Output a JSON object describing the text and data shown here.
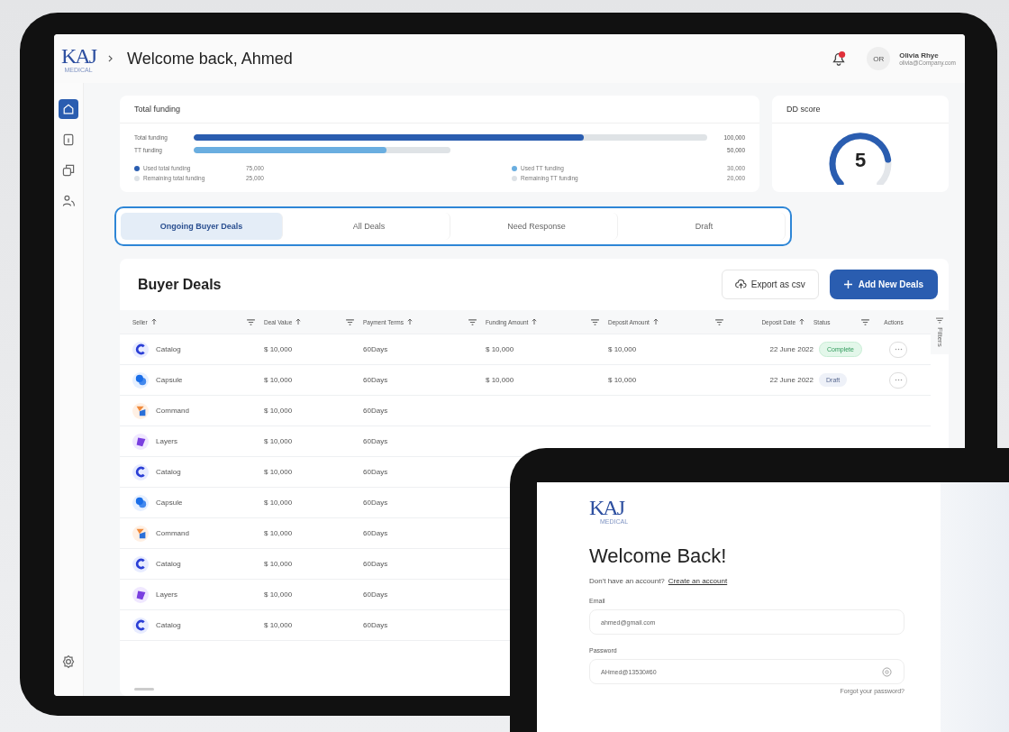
{
  "header": {
    "logo": "KAJ",
    "logo_sub": "MEDICAL",
    "greeting": "Welcome back, Ahmed",
    "notification_badge": true,
    "user": {
      "initials": "OR",
      "name": "Olivia Rhye",
      "email": "olivia@Company.com"
    }
  },
  "sidebar": {
    "items": [
      {
        "kind": "home",
        "selected": true
      },
      {
        "kind": "document",
        "selected": false
      },
      {
        "kind": "copy",
        "selected": false
      },
      {
        "kind": "users",
        "selected": false
      }
    ],
    "bottom": {
      "kind": "settings"
    }
  },
  "funding": {
    "title": "Total funding",
    "bars": [
      {
        "label": "Total funding",
        "level": 0.76,
        "value": "100,000"
      },
      {
        "label": "TT funding",
        "level": 0.75,
        "value": "50,000"
      }
    ],
    "legend": [
      {
        "label": "Used total funding",
        "value": "75,000",
        "color": "#2a5db0"
      },
      {
        "label": "Remaining total funding",
        "value": "25,000",
        "color": "#dde2e6"
      },
      {
        "label": "Used TT funding",
        "value": "30,000",
        "color": "#6aaee0"
      },
      {
        "label": "Remaining TT funding",
        "value": "20,000",
        "color": "#dde2e6"
      }
    ]
  },
  "dd_score": {
    "title": "DD score",
    "level": 0.8,
    "value": "5"
  },
  "tabs": [
    {
      "label": "Ongoing Buyer Deals",
      "selected": true
    },
    {
      "label": "All Deals",
      "selected": false
    },
    {
      "label": "Need Response",
      "selected": false
    },
    {
      "label": "Draft",
      "selected": false
    }
  ],
  "deals": {
    "title": "Buyer Deals",
    "export_button": "Export as csv",
    "add_button": "Add New Deals",
    "filters_label": "Filters",
    "columns": [
      "Seller",
      "Deal Value",
      "Payment Terms",
      "Funding Amount",
      "Deposit Amount",
      "Deposit Date",
      "Status",
      "Actions"
    ],
    "rows": [
      {
        "kind": "catalog",
        "cells": [
          "Catalog",
          "$ 10,000",
          "60Days",
          "$ 10,000",
          "$ 10,000",
          "22 June 2022"
        ],
        "status": {
          "label": "Complete",
          "kind": "complete"
        }
      },
      {
        "kind": "capsule",
        "cells": [
          "Capsule",
          "$ 10,000",
          "60Days",
          "$ 10,000",
          "$ 10,000",
          "22 June 2022"
        ],
        "status": {
          "label": "Draft",
          "kind": "draft"
        }
      },
      {
        "kind": "command",
        "cells": [
          "Command",
          "$ 10,000",
          "60Days"
        ]
      },
      {
        "kind": "layers",
        "cells": [
          "Layers",
          "$ 10,000",
          "60Days"
        ]
      },
      {
        "kind": "catalog",
        "cells": [
          "Catalog",
          "$ 10,000",
          "60Days"
        ]
      },
      {
        "kind": "capsule",
        "cells": [
          "Capsule",
          "$ 10,000",
          "60Days"
        ]
      },
      {
        "kind": "command",
        "cells": [
          "Command",
          "$ 10,000",
          "60Days"
        ]
      },
      {
        "kind": "catalog",
        "cells": [
          "Catalog",
          "$ 10,000",
          "60Days"
        ]
      },
      {
        "kind": "layers",
        "cells": [
          "Layers",
          "$ 10,000",
          "60Days"
        ]
      },
      {
        "kind": "catalog",
        "cells": [
          "Catalog",
          "$ 10,000",
          "60Days"
        ]
      }
    ]
  },
  "login": {
    "logo": "KAJ",
    "logo_sub": "MEDICAL",
    "title": "Welcome Back!",
    "prompt": "Don't have an account?",
    "link": "Create an account",
    "fields": [
      {
        "label": "Email",
        "value": "ahmed@gmail.com",
        "kind": "text"
      },
      {
        "label": "Password",
        "value": "AHmed@13530#60",
        "kind": "password"
      }
    ],
    "forgot": "Forgot your password?"
  }
}
